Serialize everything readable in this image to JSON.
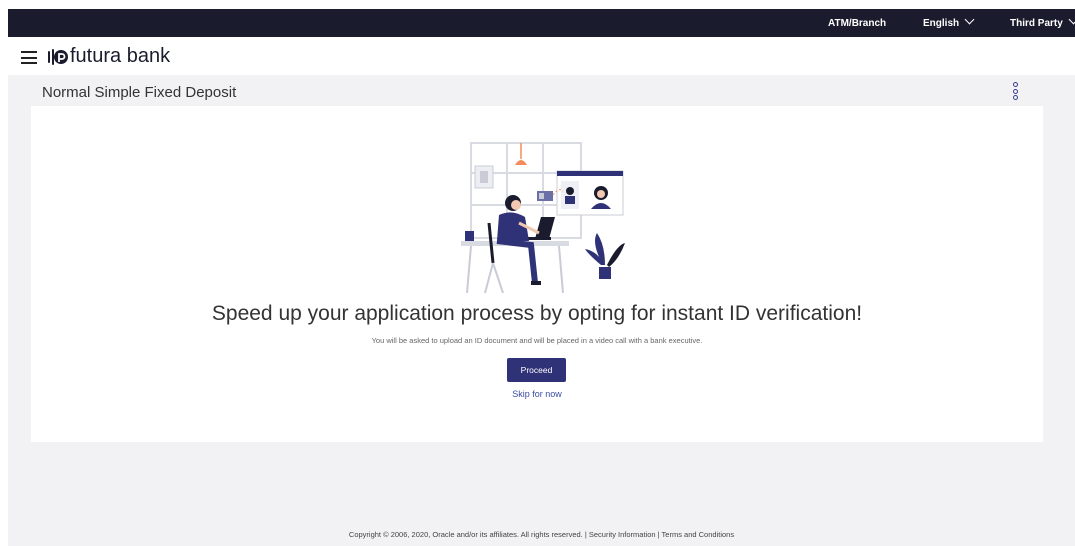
{
  "topbar": {
    "atm_branch": "ATM/Branch",
    "language": "English",
    "third_party": "Third Party"
  },
  "header": {
    "brand": "futura bank"
  },
  "page": {
    "title": "Normal Simple Fixed Deposit"
  },
  "main": {
    "headline": "Speed up your application process by opting for instant ID verification!",
    "subtext": "You will be asked to upload an ID document and will be placed in a video call with a bank executive.",
    "proceed_label": "Proceed",
    "skip_label": "Skip for now"
  },
  "footer": {
    "copyright": "Copyright © 2006, 2020, Oracle and/or its affiliates. All rights reserved. | Security Information | Terms and Conditions"
  },
  "icons": {
    "menu": "hamburger-menu-icon",
    "logo": "futura-bank-logo",
    "more": "vertical-dots-icon",
    "dropdown": "chevron-down-icon"
  },
  "colors": {
    "topbar_bg": "#1a1c2e",
    "primary_button": "#2f3276",
    "link": "#3a4ea0",
    "page_bg": "#f2f2f4",
    "accent_orange": "#f28c5a"
  }
}
